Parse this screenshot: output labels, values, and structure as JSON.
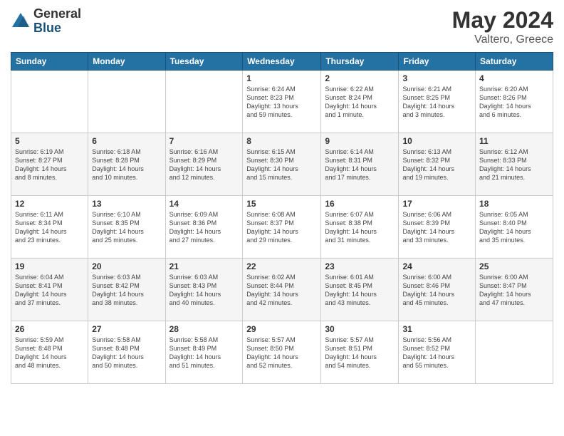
{
  "header": {
    "logo_general": "General",
    "logo_blue": "Blue",
    "month_title": "May 2024",
    "location": "Valtero, Greece"
  },
  "days_of_week": [
    "Sunday",
    "Monday",
    "Tuesday",
    "Wednesday",
    "Thursday",
    "Friday",
    "Saturday"
  ],
  "weeks": [
    [
      {
        "day": "",
        "info": ""
      },
      {
        "day": "",
        "info": ""
      },
      {
        "day": "",
        "info": ""
      },
      {
        "day": "1",
        "info": "Sunrise: 6:24 AM\nSunset: 8:23 PM\nDaylight: 13 hours\nand 59 minutes."
      },
      {
        "day": "2",
        "info": "Sunrise: 6:22 AM\nSunset: 8:24 PM\nDaylight: 14 hours\nand 1 minute."
      },
      {
        "day": "3",
        "info": "Sunrise: 6:21 AM\nSunset: 8:25 PM\nDaylight: 14 hours\nand 3 minutes."
      },
      {
        "day": "4",
        "info": "Sunrise: 6:20 AM\nSunset: 8:26 PM\nDaylight: 14 hours\nand 6 minutes."
      }
    ],
    [
      {
        "day": "5",
        "info": "Sunrise: 6:19 AM\nSunset: 8:27 PM\nDaylight: 14 hours\nand 8 minutes."
      },
      {
        "day": "6",
        "info": "Sunrise: 6:18 AM\nSunset: 8:28 PM\nDaylight: 14 hours\nand 10 minutes."
      },
      {
        "day": "7",
        "info": "Sunrise: 6:16 AM\nSunset: 8:29 PM\nDaylight: 14 hours\nand 12 minutes."
      },
      {
        "day": "8",
        "info": "Sunrise: 6:15 AM\nSunset: 8:30 PM\nDaylight: 14 hours\nand 15 minutes."
      },
      {
        "day": "9",
        "info": "Sunrise: 6:14 AM\nSunset: 8:31 PM\nDaylight: 14 hours\nand 17 minutes."
      },
      {
        "day": "10",
        "info": "Sunrise: 6:13 AM\nSunset: 8:32 PM\nDaylight: 14 hours\nand 19 minutes."
      },
      {
        "day": "11",
        "info": "Sunrise: 6:12 AM\nSunset: 8:33 PM\nDaylight: 14 hours\nand 21 minutes."
      }
    ],
    [
      {
        "day": "12",
        "info": "Sunrise: 6:11 AM\nSunset: 8:34 PM\nDaylight: 14 hours\nand 23 minutes."
      },
      {
        "day": "13",
        "info": "Sunrise: 6:10 AM\nSunset: 8:35 PM\nDaylight: 14 hours\nand 25 minutes."
      },
      {
        "day": "14",
        "info": "Sunrise: 6:09 AM\nSunset: 8:36 PM\nDaylight: 14 hours\nand 27 minutes."
      },
      {
        "day": "15",
        "info": "Sunrise: 6:08 AM\nSunset: 8:37 PM\nDaylight: 14 hours\nand 29 minutes."
      },
      {
        "day": "16",
        "info": "Sunrise: 6:07 AM\nSunset: 8:38 PM\nDaylight: 14 hours\nand 31 minutes."
      },
      {
        "day": "17",
        "info": "Sunrise: 6:06 AM\nSunset: 8:39 PM\nDaylight: 14 hours\nand 33 minutes."
      },
      {
        "day": "18",
        "info": "Sunrise: 6:05 AM\nSunset: 8:40 PM\nDaylight: 14 hours\nand 35 minutes."
      }
    ],
    [
      {
        "day": "19",
        "info": "Sunrise: 6:04 AM\nSunset: 8:41 PM\nDaylight: 14 hours\nand 37 minutes."
      },
      {
        "day": "20",
        "info": "Sunrise: 6:03 AM\nSunset: 8:42 PM\nDaylight: 14 hours\nand 38 minutes."
      },
      {
        "day": "21",
        "info": "Sunrise: 6:03 AM\nSunset: 8:43 PM\nDaylight: 14 hours\nand 40 minutes."
      },
      {
        "day": "22",
        "info": "Sunrise: 6:02 AM\nSunset: 8:44 PM\nDaylight: 14 hours\nand 42 minutes."
      },
      {
        "day": "23",
        "info": "Sunrise: 6:01 AM\nSunset: 8:45 PM\nDaylight: 14 hours\nand 43 minutes."
      },
      {
        "day": "24",
        "info": "Sunrise: 6:00 AM\nSunset: 8:46 PM\nDaylight: 14 hours\nand 45 minutes."
      },
      {
        "day": "25",
        "info": "Sunrise: 6:00 AM\nSunset: 8:47 PM\nDaylight: 14 hours\nand 47 minutes."
      }
    ],
    [
      {
        "day": "26",
        "info": "Sunrise: 5:59 AM\nSunset: 8:48 PM\nDaylight: 14 hours\nand 48 minutes."
      },
      {
        "day": "27",
        "info": "Sunrise: 5:58 AM\nSunset: 8:48 PM\nDaylight: 14 hours\nand 50 minutes."
      },
      {
        "day": "28",
        "info": "Sunrise: 5:58 AM\nSunset: 8:49 PM\nDaylight: 14 hours\nand 51 minutes."
      },
      {
        "day": "29",
        "info": "Sunrise: 5:57 AM\nSunset: 8:50 PM\nDaylight: 14 hours\nand 52 minutes."
      },
      {
        "day": "30",
        "info": "Sunrise: 5:57 AM\nSunset: 8:51 PM\nDaylight: 14 hours\nand 54 minutes."
      },
      {
        "day": "31",
        "info": "Sunrise: 5:56 AM\nSunset: 8:52 PM\nDaylight: 14 hours\nand 55 minutes."
      },
      {
        "day": "",
        "info": ""
      }
    ]
  ]
}
